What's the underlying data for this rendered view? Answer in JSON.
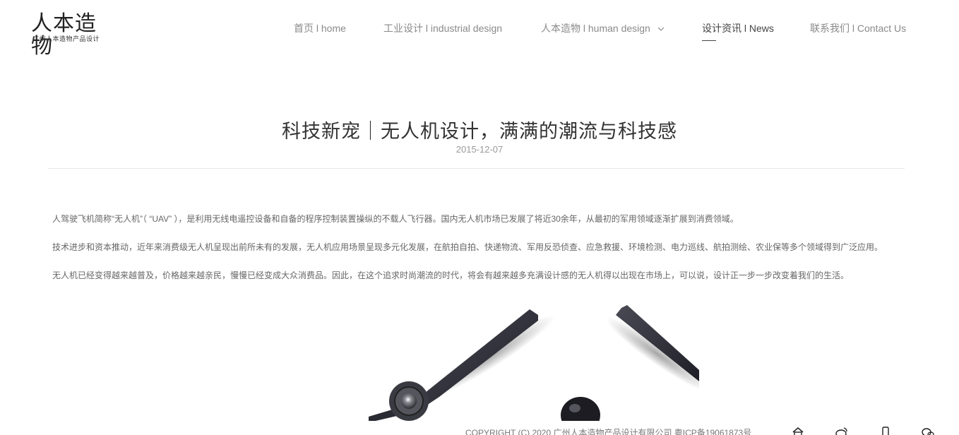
{
  "logo": {
    "mark": "人本造物",
    "tagline": "广州人本造物产品设计"
  },
  "nav": {
    "items": [
      {
        "label": "首页 l home"
      },
      {
        "label": "工业设计 l industrial design"
      },
      {
        "label": "人本造物 l human design"
      },
      {
        "label": "设计资讯 l News"
      },
      {
        "label": "联系我们 l Contact Us"
      }
    ]
  },
  "article": {
    "title": "科技新宠｜无人机设计，满满的潮流与科技感",
    "date": "2015-12-07",
    "paragraphs": [
      "人驾驶飞机简称“无人机”（ “UAV” ），是利用无线电遥控设备和自备的程序控制装置操纵的不载人飞行器。国内无人机市场已发展了将近30余年，从最初的军用领域逐渐扩展到消费领域。",
      "技术进步和资本推动，近年来消费级无人机呈现出前所未有的发展，无人机应用场景呈现多元化发展，在航拍自拍、快递物流、军用反恐侦查、应急救援、环境检测、电力巡线、航拍测绘、农业保等多个领域得到广泛应用。",
      "无人机已经变得越来越普及，价格越来越亲民，慢慢已经变成大众消费品。因此，在这个追求时尚潮流的时代，将会有越来越多充满设计感的无人机得以出现在市场上，可以说，设计正一步一步改变着我们的生活。"
    ]
  },
  "footer": {
    "copyright": "COPYRIGHT (C) 2020 广州人本造物产品设计有限公司    粤ICP备19061873号"
  },
  "icons": [
    "chevron-down-icon",
    "home-icon",
    "weibo-icon",
    "phone-icon",
    "wechat-icon"
  ]
}
